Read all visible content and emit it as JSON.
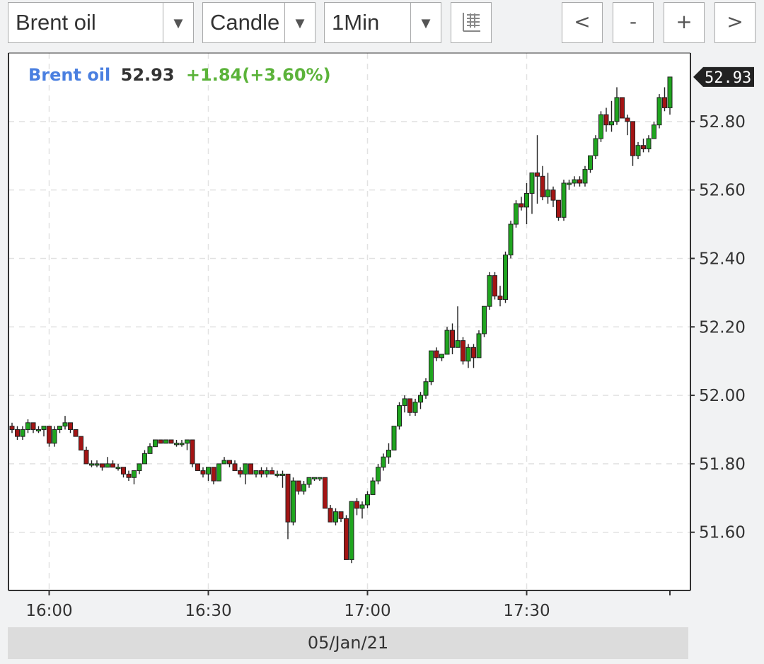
{
  "toolbar": {
    "instrument_select": "Brent oil",
    "chart_type_select": "Candle",
    "interval_select": "1Min",
    "dropdown_arrow": "▼",
    "settings_icon": "list-settings-icon",
    "nav_prev": "<",
    "zoom_out": "-",
    "zoom_in": "+",
    "nav_next": ">"
  },
  "quote": {
    "name": "Brent oil",
    "price": "52.93",
    "change": "+1.84(+3.60%)"
  },
  "date_label": "05/Jan/21",
  "colors": {
    "up": "#1fa51f",
    "down": "#a31414",
    "name": "#4a7fe0",
    "change": "#5bb33a",
    "price_tag": "#222222"
  },
  "chart_data": {
    "type": "candlestick",
    "x_tick_labels": [
      "16:00",
      "16:30",
      "17:00",
      "17:30"
    ],
    "y_tick_labels": [
      "52.80",
      "52.60",
      "52.40",
      "52.20",
      "52.00",
      "51.80",
      "51.60"
    ],
    "y_ticks": [
      52.8,
      52.6,
      52.4,
      52.2,
      52.0,
      51.8,
      51.6
    ],
    "ylim": [
      51.43,
      53.0
    ],
    "x_start": "15:53",
    "x_end": "17:57",
    "last_price_label": "52.93",
    "last_price": 52.93,
    "grid": true,
    "candles": [
      [
        "15:53",
        51.91,
        51.92,
        51.89,
        51.9
      ],
      [
        "15:54",
        51.9,
        51.91,
        51.87,
        51.88
      ],
      [
        "15:55",
        51.88,
        51.91,
        51.87,
        51.9
      ],
      [
        "15:56",
        51.9,
        51.93,
        51.89,
        51.92
      ],
      [
        "15:57",
        51.92,
        51.92,
        51.89,
        51.9
      ],
      [
        "15:58",
        51.9,
        51.91,
        51.89,
        51.9
      ],
      [
        "15:59",
        51.9,
        51.91,
        51.88,
        51.91
      ],
      [
        "16:00",
        51.91,
        51.91,
        51.85,
        51.86
      ],
      [
        "16:01",
        51.86,
        51.91,
        51.85,
        51.9
      ],
      [
        "16:02",
        51.9,
        51.91,
        51.89,
        51.91
      ],
      [
        "16:03",
        51.91,
        51.94,
        51.9,
        51.92
      ],
      [
        "16:04",
        51.92,
        51.92,
        51.89,
        51.9
      ],
      [
        "16:05",
        51.9,
        51.9,
        51.88,
        51.88
      ],
      [
        "16:06",
        51.88,
        51.88,
        51.84,
        51.84
      ],
      [
        "16:07",
        51.84,
        51.85,
        51.8,
        51.8
      ],
      [
        "16:08",
        51.8,
        51.81,
        51.79,
        51.8
      ],
      [
        "16:09",
        51.8,
        51.81,
        51.79,
        51.8
      ],
      [
        "16:10",
        51.8,
        51.8,
        51.78,
        51.79
      ],
      [
        "16:11",
        51.79,
        51.82,
        51.79,
        51.8
      ],
      [
        "16:12",
        51.8,
        51.81,
        51.79,
        51.79
      ],
      [
        "16:13",
        51.79,
        51.8,
        51.78,
        51.79
      ],
      [
        "16:14",
        51.79,
        51.79,
        51.76,
        51.77
      ],
      [
        "16:15",
        51.77,
        51.78,
        51.75,
        51.76
      ],
      [
        "16:16",
        51.76,
        51.78,
        51.74,
        51.78
      ],
      [
        "16:17",
        51.78,
        51.8,
        51.77,
        51.8
      ],
      [
        "16:18",
        51.8,
        51.84,
        51.8,
        51.83
      ],
      [
        "16:19",
        51.83,
        51.86,
        51.83,
        51.85
      ],
      [
        "16:20",
        51.85,
        51.87,
        51.85,
        51.87
      ],
      [
        "16:21",
        51.87,
        51.87,
        51.86,
        51.86
      ],
      [
        "16:22",
        51.86,
        51.87,
        51.86,
        51.87
      ],
      [
        "16:23",
        51.87,
        51.87,
        51.86,
        51.86
      ],
      [
        "16:24",
        51.86,
        51.87,
        51.85,
        51.86
      ],
      [
        "16:25",
        51.86,
        51.87,
        51.85,
        51.86
      ],
      [
        "16:26",
        51.86,
        51.87,
        51.84,
        51.87
      ],
      [
        "16:27",
        51.87,
        51.87,
        51.79,
        51.8
      ],
      [
        "16:28",
        51.8,
        51.8,
        51.78,
        51.78
      ],
      [
        "16:29",
        51.78,
        51.79,
        51.76,
        51.77
      ],
      [
        "16:30",
        51.77,
        51.79,
        51.75,
        51.79
      ],
      [
        "16:31",
        51.79,
        51.79,
        51.74,
        51.75
      ],
      [
        "16:32",
        51.75,
        51.8,
        51.75,
        51.8
      ],
      [
        "16:33",
        51.8,
        51.82,
        51.8,
        51.81
      ],
      [
        "16:34",
        51.81,
        51.81,
        51.79,
        51.8
      ],
      [
        "16:35",
        51.8,
        51.81,
        51.78,
        51.78
      ],
      [
        "16:36",
        51.78,
        51.79,
        51.76,
        51.77
      ],
      [
        "16:37",
        51.77,
        51.8,
        51.74,
        51.8
      ],
      [
        "16:38",
        51.8,
        51.8,
        51.77,
        51.77
      ],
      [
        "16:39",
        51.77,
        51.78,
        51.76,
        51.78
      ],
      [
        "16:40",
        51.78,
        51.79,
        51.76,
        51.77
      ],
      [
        "16:41",
        51.77,
        51.79,
        51.76,
        51.78
      ],
      [
        "16:42",
        51.78,
        51.79,
        51.77,
        51.77
      ],
      [
        "16:43",
        51.77,
        51.78,
        51.76,
        51.77
      ],
      [
        "16:44",
        51.77,
        51.78,
        51.73,
        51.77
      ],
      [
        "16:45",
        51.77,
        51.77,
        51.58,
        51.63
      ],
      [
        "16:46",
        51.63,
        51.76,
        51.62,
        51.75
      ],
      [
        "16:47",
        51.75,
        51.75,
        51.71,
        51.72
      ],
      [
        "16:48",
        51.72,
        51.75,
        51.71,
        51.74
      ],
      [
        "16:49",
        51.74,
        51.76,
        51.73,
        51.76
      ],
      [
        "16:50",
        51.76,
        51.76,
        51.75,
        51.76
      ],
      [
        "16:51",
        51.76,
        51.76,
        51.75,
        51.76
      ],
      [
        "16:52",
        51.76,
        51.76,
        51.67,
        51.67
      ],
      [
        "16:53",
        51.67,
        51.68,
        51.63,
        51.63
      ],
      [
        "16:54",
        51.63,
        51.67,
        51.62,
        51.66
      ],
      [
        "16:55",
        51.66,
        51.66,
        51.63,
        51.64
      ],
      [
        "16:56",
        51.64,
        51.65,
        51.52,
        51.52
      ],
      [
        "16:57",
        51.52,
        51.69,
        51.51,
        51.69
      ],
      [
        "16:58",
        51.69,
        51.7,
        51.65,
        51.67
      ],
      [
        "16:59",
        51.67,
        51.69,
        51.64,
        51.68
      ],
      [
        "17:00",
        51.68,
        51.72,
        51.67,
        51.71
      ],
      [
        "17:01",
        51.71,
        51.76,
        51.71,
        51.75
      ],
      [
        "17:02",
        51.75,
        51.8,
        51.74,
        51.79
      ],
      [
        "17:03",
        51.79,
        51.83,
        51.78,
        51.82
      ],
      [
        "17:04",
        51.82,
        51.86,
        51.8,
        51.84
      ],
      [
        "17:05",
        51.84,
        51.91,
        51.84,
        51.91
      ],
      [
        "17:06",
        51.91,
        51.98,
        51.9,
        51.97
      ],
      [
        "17:07",
        51.97,
        52.0,
        51.95,
        51.99
      ],
      [
        "17:08",
        51.99,
        51.99,
        51.94,
        51.95
      ],
      [
        "17:09",
        51.95,
        51.99,
        51.94,
        51.98
      ],
      [
        "17:10",
        51.98,
        52.01,
        51.96,
        52.0
      ],
      [
        "17:11",
        52.0,
        52.05,
        51.99,
        52.04
      ],
      [
        "17:12",
        52.04,
        52.13,
        52.03,
        52.13
      ],
      [
        "17:13",
        52.13,
        52.14,
        52.1,
        52.11
      ],
      [
        "17:14",
        52.11,
        52.12,
        52.1,
        52.12
      ],
      [
        "17:15",
        52.12,
        52.2,
        52.12,
        52.19
      ],
      [
        "17:16",
        52.19,
        52.21,
        52.12,
        52.14
      ],
      [
        "17:17",
        52.14,
        52.26,
        52.14,
        52.16
      ],
      [
        "17:18",
        52.16,
        52.17,
        52.09,
        52.1
      ],
      [
        "17:19",
        52.1,
        52.15,
        52.08,
        52.14
      ],
      [
        "17:20",
        52.14,
        52.15,
        52.08,
        52.11
      ],
      [
        "17:21",
        52.11,
        52.19,
        52.11,
        52.18
      ],
      [
        "17:22",
        52.18,
        52.26,
        52.17,
        52.26
      ],
      [
        "17:23",
        52.26,
        52.36,
        52.25,
        52.35
      ],
      [
        "17:24",
        52.35,
        52.36,
        52.28,
        52.29
      ],
      [
        "17:25",
        52.29,
        52.32,
        52.26,
        52.28
      ],
      [
        "17:26",
        52.28,
        52.42,
        52.27,
        52.41
      ],
      [
        "17:27",
        52.41,
        52.51,
        52.4,
        52.5
      ],
      [
        "17:28",
        52.5,
        52.57,
        52.49,
        52.56
      ],
      [
        "17:29",
        52.56,
        52.58,
        52.54,
        52.55
      ],
      [
        "17:30",
        52.55,
        52.62,
        52.5,
        52.59
      ],
      [
        "17:31",
        52.59,
        52.65,
        52.53,
        52.65
      ],
      [
        "17:32",
        52.65,
        52.76,
        52.56,
        52.64
      ],
      [
        "17:33",
        52.64,
        52.67,
        52.57,
        52.58
      ],
      [
        "17:34",
        52.58,
        52.65,
        52.56,
        52.6
      ],
      [
        "17:35",
        52.6,
        52.61,
        52.55,
        52.57
      ],
      [
        "17:36",
        52.57,
        52.57,
        52.51,
        52.52
      ],
      [
        "17:37",
        52.52,
        52.63,
        52.51,
        52.62
      ],
      [
        "17:38",
        52.62,
        52.63,
        52.6,
        52.62
      ],
      [
        "17:39",
        52.62,
        52.64,
        52.61,
        52.63
      ],
      [
        "17:40",
        52.63,
        52.64,
        52.61,
        52.62
      ],
      [
        "17:41",
        52.62,
        52.67,
        52.61,
        52.66
      ],
      [
        "17:42",
        52.66,
        52.7,
        52.65,
        52.7
      ],
      [
        "17:43",
        52.7,
        52.76,
        52.69,
        52.75
      ],
      [
        "17:44",
        52.75,
        52.83,
        52.74,
        52.82
      ],
      [
        "17:45",
        52.82,
        52.84,
        52.77,
        52.79
      ],
      [
        "17:46",
        52.79,
        52.86,
        52.77,
        52.8
      ],
      [
        "17:47",
        52.8,
        52.9,
        52.79,
        52.87
      ],
      [
        "17:48",
        52.87,
        52.87,
        52.81,
        52.81
      ],
      [
        "17:49",
        52.81,
        52.82,
        52.76,
        52.8
      ],
      [
        "17:50",
        52.8,
        52.8,
        52.67,
        52.7
      ],
      [
        "17:51",
        52.7,
        52.74,
        52.69,
        52.73
      ],
      [
        "17:52",
        52.73,
        52.75,
        52.71,
        52.72
      ],
      [
        "17:53",
        52.72,
        52.76,
        52.71,
        52.75
      ],
      [
        "17:54",
        52.75,
        52.8,
        52.75,
        52.79
      ],
      [
        "17:55",
        52.79,
        52.88,
        52.78,
        52.87
      ],
      [
        "17:56",
        52.87,
        52.9,
        52.83,
        52.84
      ],
      [
        "17:57",
        52.84,
        52.93,
        52.82,
        52.93
      ]
    ]
  }
}
